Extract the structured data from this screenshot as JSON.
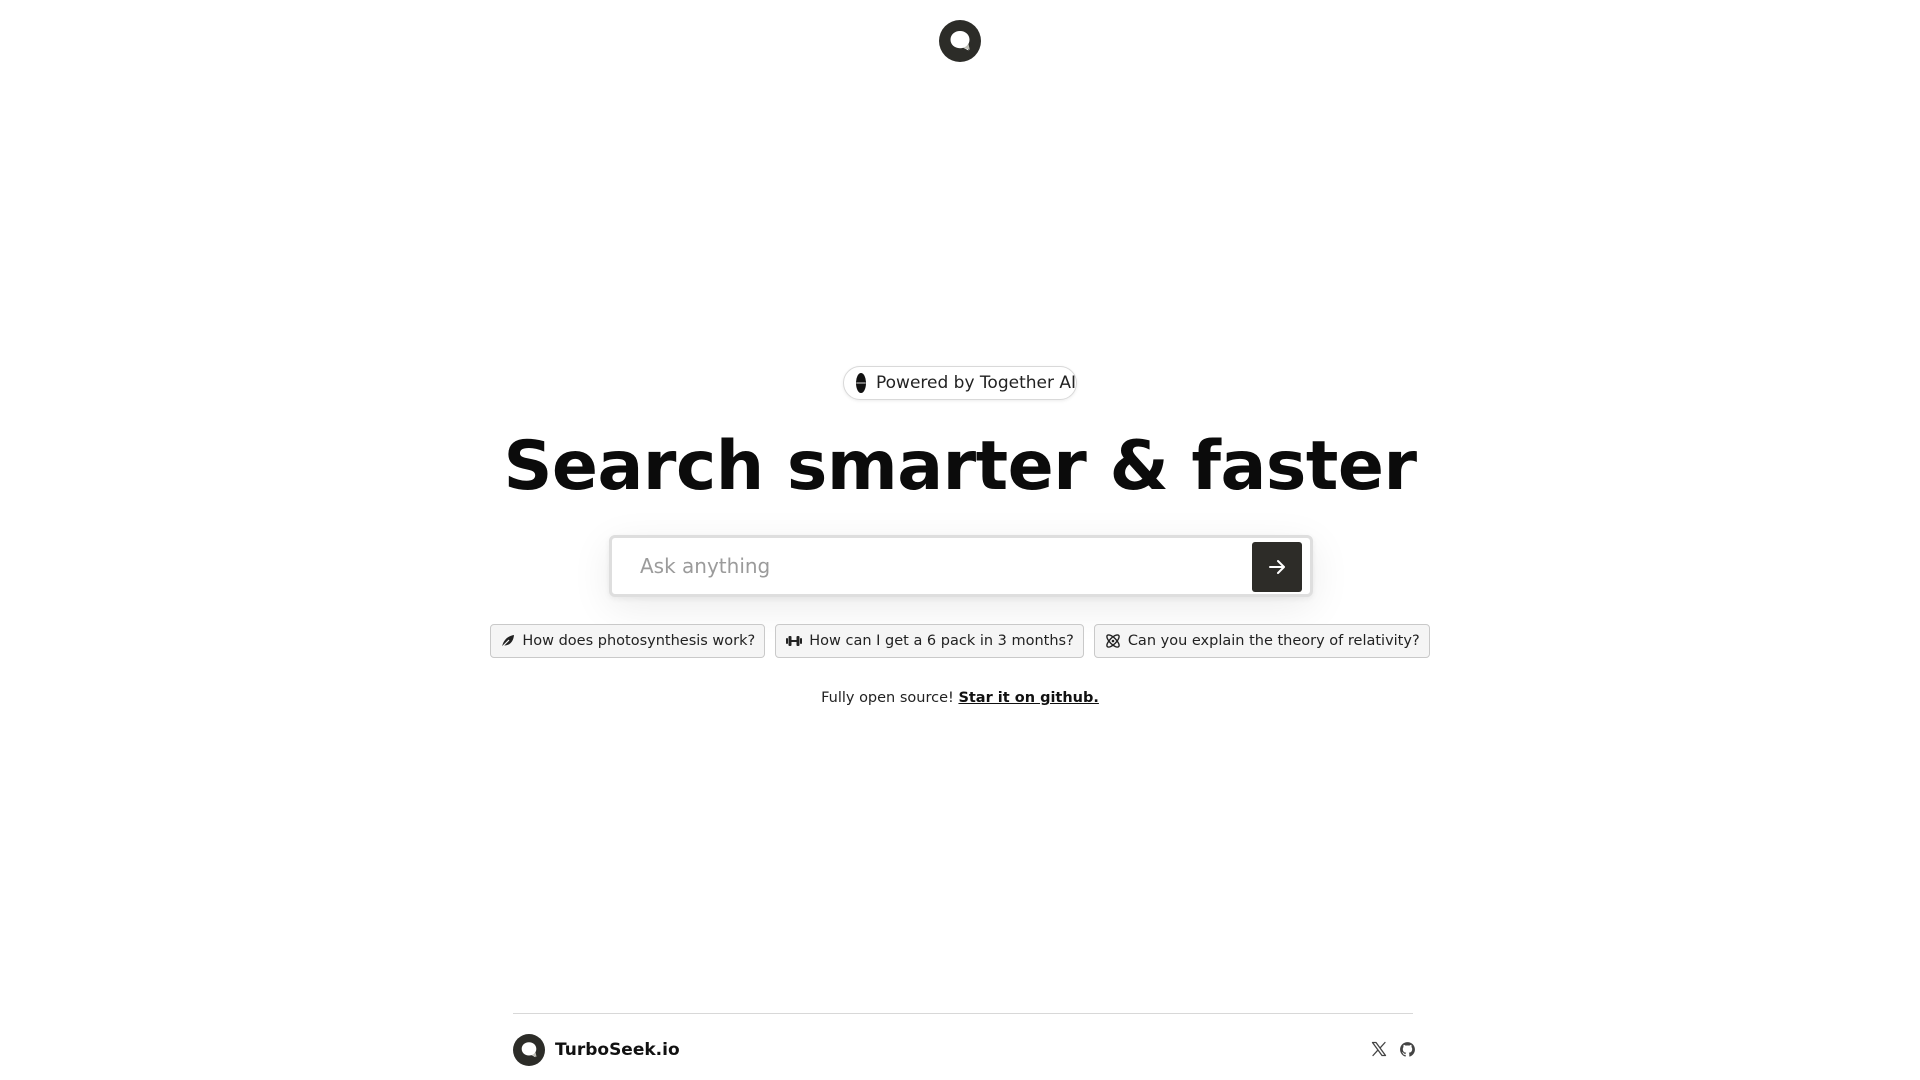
{
  "header": {
    "logo_icon": "chat-bubble-icon"
  },
  "badge": {
    "label": "Powered by Together AI",
    "icon": "together-ai-logo-icon"
  },
  "hero": {
    "title": "Search smarter & faster"
  },
  "search": {
    "placeholder": "Ask anything",
    "value": "",
    "submit_icon": "arrow-right-icon"
  },
  "suggestions": [
    {
      "label": "How does photosynthesis work?",
      "icon": "leaf-icon"
    },
    {
      "label": "How can I get a 6 pack in 3 months?",
      "icon": "dumbbell-icon"
    },
    {
      "label": "Can you explain the theory of relativity?",
      "icon": "atom-icon"
    }
  ],
  "open_source": {
    "text": "Fully open source! ",
    "link_label": "Star it on github."
  },
  "footer": {
    "brand_name": "TurboSeek.io",
    "social": [
      {
        "icon": "x-twitter-icon"
      },
      {
        "icon": "github-icon"
      }
    ]
  },
  "colors": {
    "accent_dark": "#2d2c28",
    "text": "#111111",
    "chip_bg": "#f5f5f5",
    "border": "#d8d8d8"
  }
}
